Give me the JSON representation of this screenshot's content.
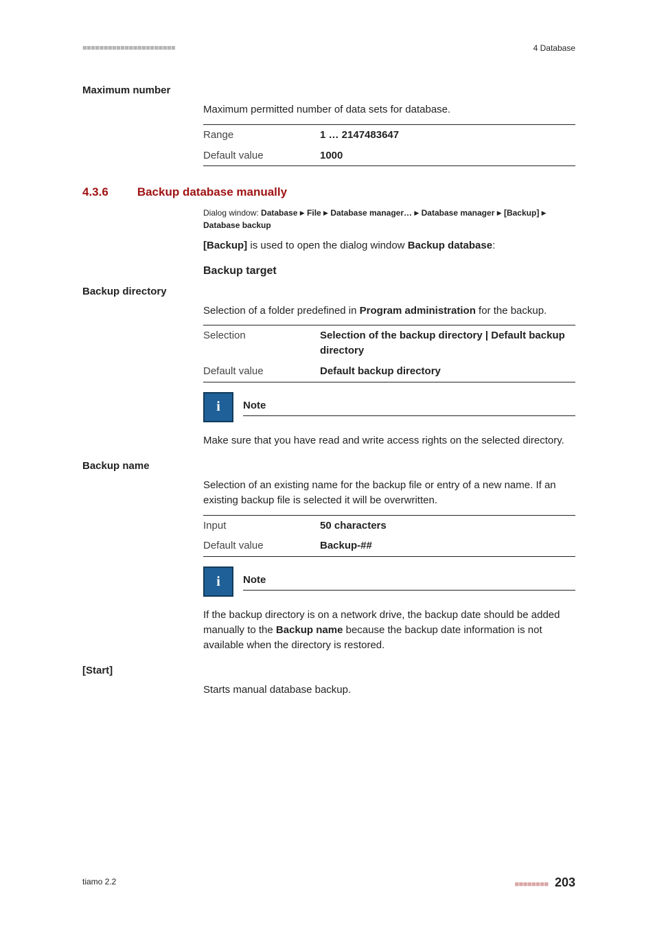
{
  "header": {
    "dashes": "■■■■■■■■■■■■■■■■■■■■■■",
    "chapter": "4 Database"
  },
  "block_max": {
    "label": "Maximum number",
    "desc": "Maximum permitted number of data sets for database.",
    "rows": [
      {
        "k": "Range",
        "v": "1 … 2147483647"
      },
      {
        "k": "Default value",
        "v": "1000"
      }
    ]
  },
  "section": {
    "num": "4.3.6",
    "title": "Backup database manually",
    "dialog_prefix": "Dialog window: ",
    "dialog_parts": [
      "Database",
      "File",
      "Database manager…",
      "Database manager",
      "[Backup]",
      "Database backup"
    ],
    "open_text_pre": "[Backup]",
    "open_text_mid": " is used to open the dialog window ",
    "open_text_post": "Backup database",
    "open_text_end": ":",
    "sub1": "Backup target"
  },
  "block_dir": {
    "label": "Backup directory",
    "desc_pre": "Selection of a folder predefined in ",
    "desc_bold": "Program administration",
    "desc_post": " for the backup.",
    "rows": [
      {
        "k": "Selection",
        "v": "Selection of the backup directory | Default backup directory"
      },
      {
        "k": "Default value",
        "v": "Default backup directory"
      }
    ],
    "note_title": "Note",
    "note_body": "Make sure that you have read and write access rights on the selected directory."
  },
  "block_name": {
    "label": "Backup name",
    "desc": "Selection of an existing name for the backup file or entry of a new name. If an existing backup file is selected it will be overwritten.",
    "rows": [
      {
        "k": "Input",
        "v": "50 characters"
      },
      {
        "k": "Default value",
        "v": "Backup-##"
      }
    ],
    "note_title": "Note",
    "note_body_pre": "If the backup directory is on a network drive, the backup date should be added manually to the ",
    "note_body_bold": "Backup name",
    "note_body_post": " because the backup date information is not available when the directory is restored."
  },
  "block_start": {
    "label": "[Start]",
    "desc": "Starts manual database backup."
  },
  "footer": {
    "product": "tiamo 2.2",
    "dashes": "■■■■■■■■",
    "page": "203"
  }
}
